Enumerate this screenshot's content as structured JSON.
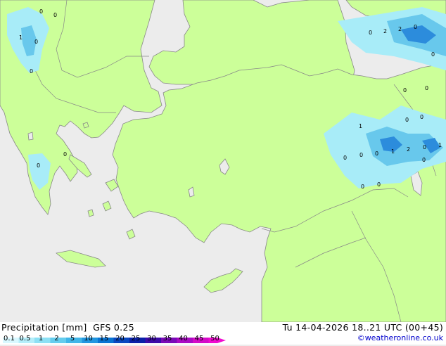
{
  "map": {
    "colors": {
      "sea": "#ececec",
      "land": "#ccff99",
      "coast": "#888888",
      "precip_light": "#a8ecf8",
      "precip_mid": "#68c8ec",
      "precip_heavy": "#2c8cdc"
    },
    "precip_values": [
      {
        "id": "p1",
        "label": "0"
      },
      {
        "id": "p2",
        "label": "0"
      },
      {
        "id": "p3",
        "label": "1"
      },
      {
        "id": "p4",
        "label": "0"
      },
      {
        "id": "p5",
        "label": "0"
      },
      {
        "id": "p6",
        "label": "0"
      },
      {
        "id": "p7",
        "label": "0"
      },
      {
        "id": "p8",
        "label": "2"
      },
      {
        "id": "p9",
        "label": "2"
      },
      {
        "id": "p10",
        "label": "0"
      },
      {
        "id": "p11",
        "label": "0"
      },
      {
        "id": "p12",
        "label": "0"
      },
      {
        "id": "p13",
        "label": "0"
      },
      {
        "id": "p14",
        "label": "0"
      },
      {
        "id": "p15",
        "label": "0"
      },
      {
        "id": "p16",
        "label": "1"
      },
      {
        "id": "p17",
        "label": "0"
      },
      {
        "id": "p18",
        "label": "0"
      },
      {
        "id": "p19",
        "label": "0"
      },
      {
        "id": "p20",
        "label": "1"
      },
      {
        "id": "p21",
        "label": "2"
      },
      {
        "id": "p22",
        "label": "0"
      },
      {
        "id": "p23",
        "label": "1"
      },
      {
        "id": "p24",
        "label": "0"
      },
      {
        "id": "p25",
        "label": "0"
      },
      {
        "id": "p26",
        "label": "0"
      },
      {
        "id": "p27",
        "label": "0"
      }
    ]
  },
  "footer": {
    "title": "Precipitation [mm]  GFS 0.25",
    "datetime": "Tu 14-04-2026 18..21 UTC (00+45)",
    "credit": "©weatheronline.co.uk"
  },
  "legend": {
    "ticks": [
      "0.1",
      "0.5",
      "1",
      "2",
      "5",
      "10",
      "15",
      "20",
      "25",
      "30",
      "35",
      "40",
      "45",
      "50"
    ],
    "colors": [
      "#d8f8ff",
      "#b4eefa",
      "#8ce0f4",
      "#64cdee",
      "#40b6e8",
      "#2096e0",
      "#0a74d2",
      "#0a48c0",
      "#0a20a8",
      "#3c0aa8",
      "#7a0ab8",
      "#aa0ac4",
      "#d40ac8",
      "#f00ad0"
    ]
  }
}
